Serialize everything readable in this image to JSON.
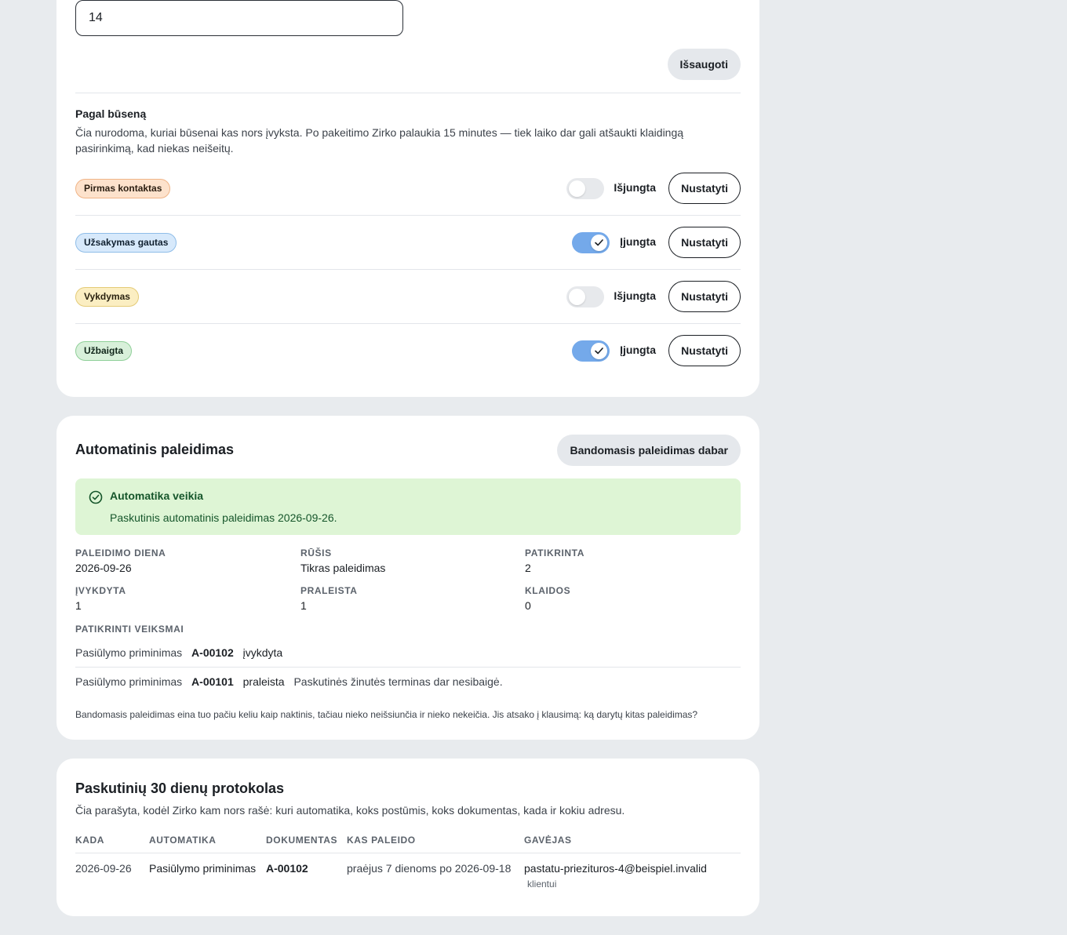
{
  "interval_input": {
    "value": "14"
  },
  "save_label": "Išsaugoti",
  "by_status": {
    "title": "Pagal būseną",
    "description": "Čia nurodoma, kuriai būsenai kas nors įvyksta. Po pakeitimo Zirko palaukia 15 minutes — tiek laiko dar gali atšaukti klaidingą pasirinkimą, kad niekas neišeitų.",
    "rows": [
      {
        "status": "Pirmas kontaktas",
        "state": "Išjungta",
        "enabled": false,
        "action": "Nustatyti"
      },
      {
        "status": "Užsakymas gautas",
        "state": "Įjungta",
        "enabled": true,
        "action": "Nustatyti"
      },
      {
        "status": "Vykdymas",
        "state": "Išjungta",
        "enabled": false,
        "action": "Nustatyti"
      },
      {
        "status": "Užbaigta",
        "state": "Įjungta",
        "enabled": true,
        "action": "Nustatyti"
      }
    ]
  },
  "auto_run": {
    "title": "Automatinis paleidimas",
    "test_button": "Bandomasis paleidimas dabar",
    "alert": {
      "icon": "check-circle-icon",
      "title": "Automatika veikia",
      "text": "Paskutinis automatinis paleidimas 2026-09-26."
    },
    "stats": {
      "run_day": {
        "label": "PALEIDIMO DIENA",
        "value": "2026-09-26"
      },
      "kind": {
        "label": "RŪŠIS",
        "value": "Tikras paleidimas"
      },
      "checked": {
        "label": "PATIKRINTA",
        "value": "2"
      },
      "done": {
        "label": "ĮVYKDYTA",
        "value": "1"
      },
      "skipped": {
        "label": "PRALEISTA",
        "value": "1"
      },
      "errors": {
        "label": "KLAIDOS",
        "value": "0"
      }
    },
    "checked_actions_title": "PATIKRINTI VEIKSMAI",
    "actions": [
      {
        "type": "Pasiūlymo priminimas",
        "doc": "A-00102",
        "status": "įvykdyta",
        "note": ""
      },
      {
        "type": "Pasiūlymo priminimas",
        "doc": "A-00101",
        "status": "praleista",
        "note": "Paskutinės žinutės terminas dar nesibaigė."
      }
    ],
    "footnote": "Bandomasis paleidimas eina tuo pačiu keliu kaip naktinis, tačiau nieko neišsiunčia ir nieko nekeičia. Jis atsako į klausimą: ką darytų kitas paleidimas?"
  },
  "protocol": {
    "title": "Paskutinių 30 dienų protokolas",
    "description": "Čia parašyta, kodėl Zirko kam nors rašė: kuri automatika, koks postūmis, koks dokumentas, kada ir kokiu adresu.",
    "headers": {
      "when": "KADA",
      "automation": "AUTOMATIKA",
      "document": "DOKUMENTAS",
      "trigger": "KAS PALEIDO",
      "recipient": "GAVĖJAS"
    },
    "rows": [
      {
        "when": "2026-09-26",
        "automation": "Pasiūlymo priminimas",
        "document": "A-00102",
        "trigger": "praėjus 7 dienoms po 2026-09-18",
        "recipient": "pastatu-priezituros-4@beispiel.invalid",
        "recipient_role": "klientui"
      }
    ]
  }
}
